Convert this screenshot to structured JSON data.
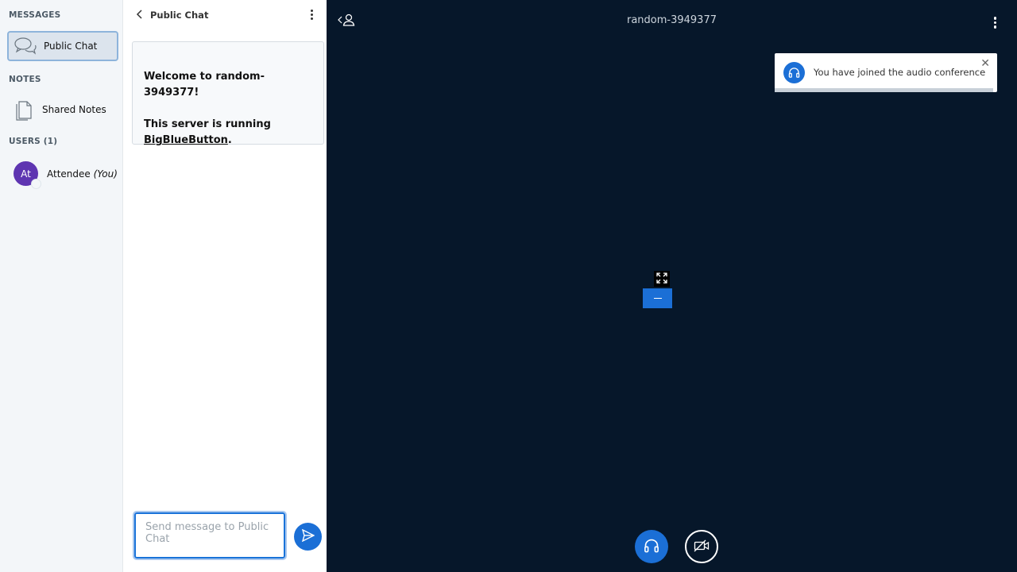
{
  "nav": {
    "messages_heading": "MESSAGES",
    "public_chat_label": "Public Chat",
    "notes_heading": "NOTES",
    "shared_notes_label": "Shared Notes",
    "users_heading": "USERS (1)",
    "user": {
      "initials": "At",
      "name": "Attendee",
      "self_tag": "(You)"
    }
  },
  "chat": {
    "title": "Public Chat",
    "welcome": {
      "line1_prefix": "Welcome to ",
      "meeting_name": "random-3949377",
      "line1_suffix": "!",
      "line2_prefix": "This server is running",
      "link_text": "BigBlueButton",
      "line2_suffix": "."
    },
    "input_placeholder": "Send message to Public Chat"
  },
  "main": {
    "meeting_title": "random-3949377",
    "toast_text": "You have joined the audio conference"
  },
  "colors": {
    "accent": "#1b6fd6",
    "main_bg": "#06172a",
    "avatar": "#5e35b1"
  }
}
